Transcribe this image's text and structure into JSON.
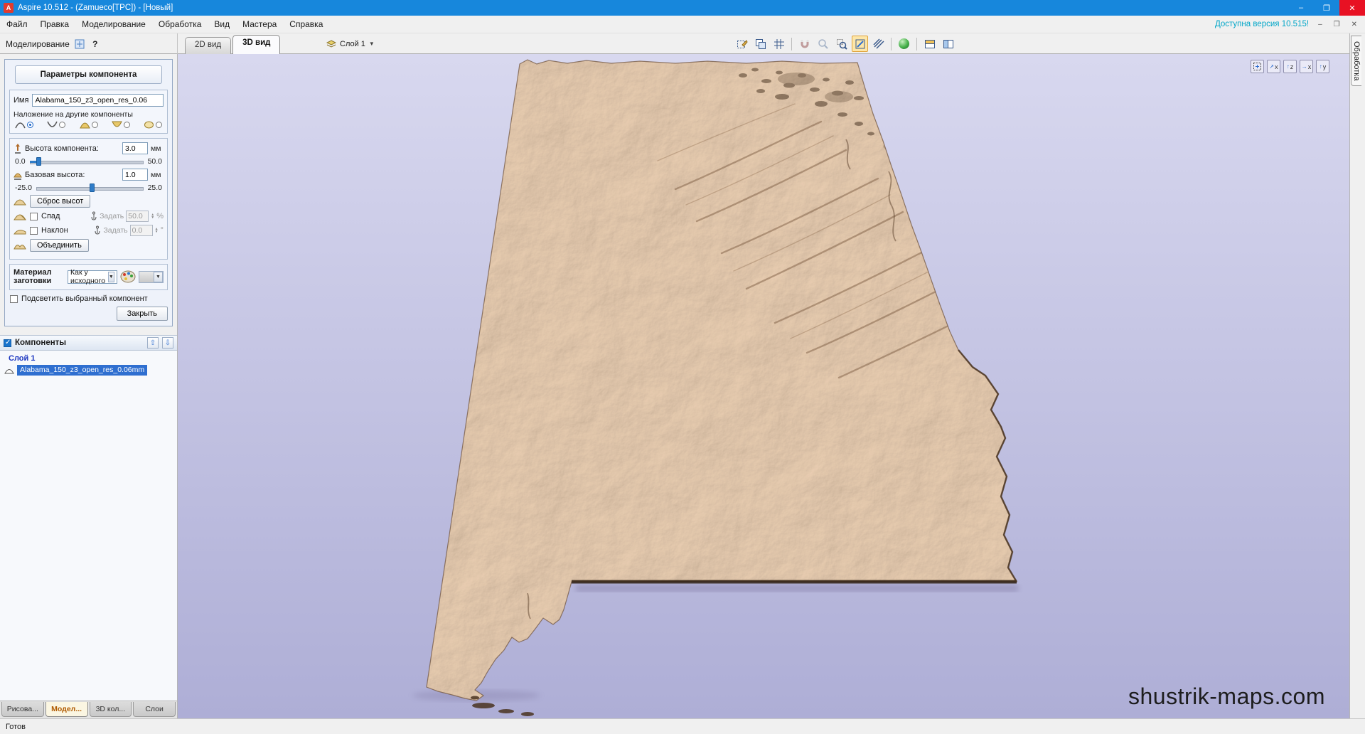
{
  "colors": {
    "titlebar_blue": "#1787dc",
    "close_red": "#e81123",
    "selection_blue": "#2f6fd0",
    "canvas_top": "#d8d8ef",
    "canvas_bottom": "#aeaed6",
    "version_teal": "#00a6c8",
    "relief_tan": "#ecd0b4",
    "active_tab_text": "#b05a00"
  },
  "window": {
    "title": "Aspire 10.512 - (Zamueco[TPC]) - [Новый]",
    "minimize": "–",
    "maximize": "❐",
    "close": "✕"
  },
  "menubar": {
    "items": [
      "Файл",
      "Правка",
      "Моделирование",
      "Обработка",
      "Вид",
      "Мастера",
      "Справка"
    ],
    "update_notice": "Доступна версия 10.515!",
    "mdi_minimize": "–",
    "mdi_restore": "❐",
    "mdi_close": "✕"
  },
  "toolbar": {
    "panel_title": "Моделирование",
    "help_label": "?",
    "tab_2d": "2D вид",
    "tab_3d": "3D вид",
    "layer_label": "Слой 1"
  },
  "right_tab_label": "Обработка",
  "params": {
    "title": "Параметры компонента",
    "name_label": "Имя",
    "name_value": "Alabama_150_z3_open_res_0.06",
    "combine_label": "Наложение на другие компоненты",
    "height_label": "Высота компонента:",
    "height_value": "3.0",
    "height_unit": "мм",
    "height_min": "0.0",
    "height_max": "50.0",
    "base_label": "Базовая высота:",
    "base_value": "1.0",
    "base_unit": "мм",
    "base_min": "-25.0",
    "base_max": "25.0",
    "reset_label": "Сброс высот",
    "fade_label": "Спад",
    "set_label": "Задать",
    "fade_value": "50.0",
    "fade_unit": "%",
    "tilt_label": "Наклон",
    "tilt_value": "0.0",
    "tilt_unit": "°",
    "merge_label": "Объединить",
    "material_label_1": "Материал",
    "material_label_2": "заготовки",
    "material_value": "Как у исходного",
    "highlight_label": "Подсветить выбранный компонент",
    "close_label": "Закрыть"
  },
  "components": {
    "title": "Компоненты",
    "layer_name": "Слой 1",
    "item_name": "Alabama_150_z3_open_res_0.06mm"
  },
  "bottom_tabs": [
    "Рисова...",
    "Модел...",
    "3D кол...",
    "Слои"
  ],
  "canvas": {
    "watermark": "shustrik-maps.com",
    "view_labels": [
      "x",
      "z",
      "x",
      "y"
    ]
  },
  "statusbar": "Готов"
}
